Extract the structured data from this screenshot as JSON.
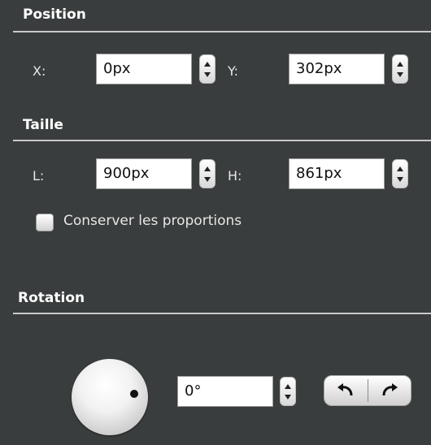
{
  "position": {
    "title": "Position",
    "x_label": "X:",
    "x_value": "0px",
    "y_label": "Y:",
    "y_value": "302px"
  },
  "size": {
    "title": "Taille",
    "w_label": "L:",
    "w_value": "900px",
    "h_label": "H:",
    "h_value": "861px",
    "keep_ratio_label": "Conserver les proportions",
    "keep_ratio_checked": false
  },
  "rotation": {
    "title": "Rotation",
    "angle_value": "0°"
  },
  "icons": {
    "stepper": "stepper-arrows-icon",
    "rotate_left": "rotate-left-icon",
    "rotate_right": "rotate-right-icon",
    "knob": "rotation-knob-icon"
  }
}
